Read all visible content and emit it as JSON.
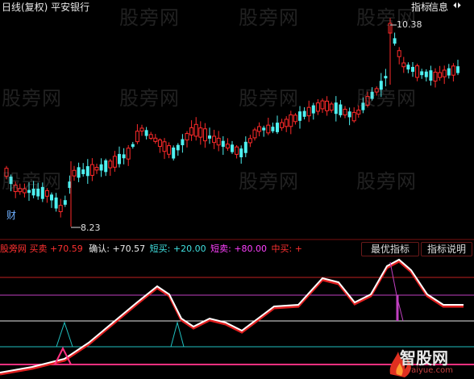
{
  "title_bar": {
    "left_text": "日线(复权) 平安银行",
    "buttons": [
      "指标",
      "信息",
      "⏴⏵"
    ]
  },
  "watermarks": [
    "股旁网",
    "股旁网",
    "股旁网",
    "股旁网",
    "股旁网",
    "股旁网",
    "股旁网",
    "股旁网",
    "股旁网",
    "股旁网"
  ],
  "price_chart": {
    "high_label": "10.38",
    "low_label": "8.23",
    "cai_label": "财",
    "up_color": "#ff2a2a",
    "down_color": "#4ef0f0"
  },
  "indicator_header": {
    "name": "股旁网 买卖",
    "name_value": "+70.59",
    "confirm_label": "确认:",
    "confirm_value": "+70.57",
    "short_buy_label": "短买:",
    "short_buy_value": "+20.00",
    "short_sell_label": "短卖:",
    "short_sell_value": "+80.00",
    "mid_buy_label": "中买:",
    "mid_buy_value": "+"
  },
  "indicator_buttons": {
    "best": "最优指标",
    "help": "指标说明"
  },
  "brand": {
    "name": "智股网",
    "url": "raiyue.com"
  }
}
